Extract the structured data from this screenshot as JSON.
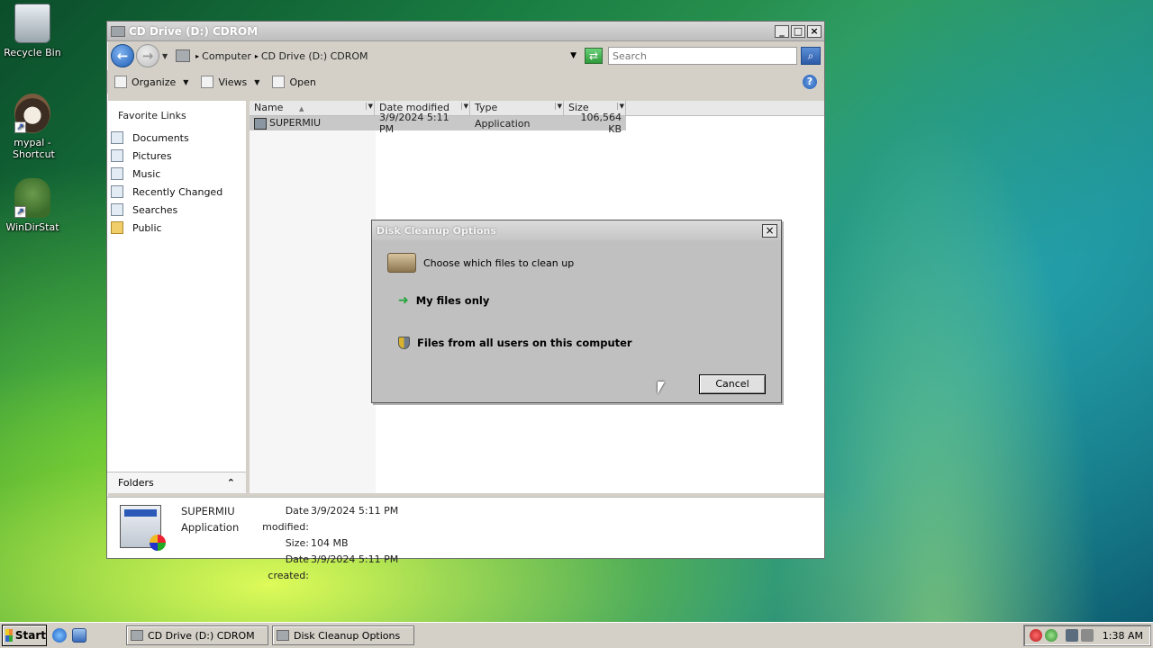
{
  "desktop": {
    "icons": [
      {
        "label": "Recycle Bin"
      },
      {
        "label": "mypal - Shortcut"
      },
      {
        "label": "WinDirStat"
      }
    ]
  },
  "explorer": {
    "title": "CD Drive (D:) CDROM",
    "address": {
      "crumbs": [
        "Computer",
        "CD Drive (D:) CDROM"
      ]
    },
    "search_placeholder": "Search",
    "toolbar": {
      "organize": "Organize",
      "views": "Views",
      "open": "Open"
    },
    "nav": {
      "header": "Favorite Links",
      "links": [
        "Documents",
        "Pictures",
        "Music",
        "Recently Changed",
        "Searches",
        "Public"
      ],
      "folders_label": "Folders"
    },
    "columns": [
      "Name",
      "Date modified",
      "Type",
      "Size"
    ],
    "files": [
      {
        "name": "SUPERMIU",
        "date": "3/9/2024 5:11 PM",
        "type": "Application",
        "size": "106,564 KB"
      }
    ],
    "details": {
      "name": "SUPERMIU",
      "type": "Application",
      "modified_label": "Date modified:",
      "modified": "3/9/2024 5:11 PM",
      "size_label": "Size:",
      "size": "104 MB",
      "created_label": "Date created:",
      "created": "3/9/2024 5:11 PM"
    }
  },
  "dialog": {
    "title": "Disk Cleanup Options",
    "prompt": "Choose which files to clean up",
    "option_mine": "My files only",
    "option_all": "Files from all users on this computer",
    "cancel": "Cancel"
  },
  "taskbar": {
    "start": "Start",
    "tasks": [
      "CD Drive (D:) CDROM",
      "Disk Cleanup Options"
    ],
    "clock": "1:38 AM"
  }
}
